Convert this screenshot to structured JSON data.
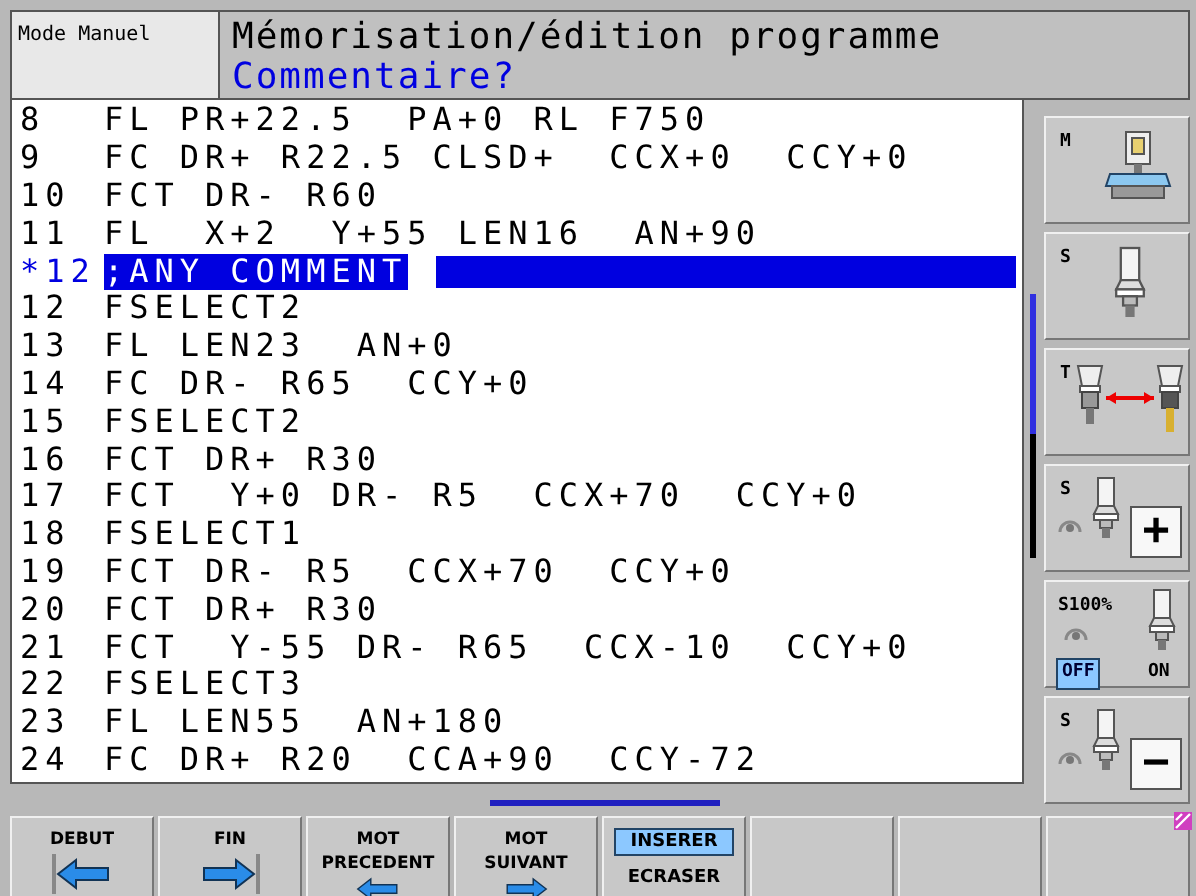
{
  "header": {
    "mode": "Mode Manuel",
    "title": "Mémorisation/édition programme",
    "prompt": "Commentaire?"
  },
  "program": {
    "lines": [
      {
        "number": "8",
        "text": "FL PR+22.5  PA+0 RL F750",
        "selected": false
      },
      {
        "number": "9",
        "text": "FC DR+ R22.5 CLSD+  CCX+0  CCY+0",
        "selected": false
      },
      {
        "number": "10",
        "text": "FCT DR- R60",
        "selected": false
      },
      {
        "number": "11",
        "text": "FL  X+2  Y+55 LEN16  AN+90",
        "selected": false
      },
      {
        "number": "*12",
        "text": ";ANY COMMENT",
        "selected": true
      },
      {
        "number": "12",
        "text": "FSELECT2",
        "selected": false
      },
      {
        "number": "13",
        "text": "FL LEN23  AN+0",
        "selected": false
      },
      {
        "number": "14",
        "text": "FC DR- R65  CCY+0",
        "selected": false
      },
      {
        "number": "15",
        "text": "FSELECT2",
        "selected": false
      },
      {
        "number": "16",
        "text": "FCT DR+ R30",
        "selected": false
      },
      {
        "number": "17",
        "text": "FCT  Y+0 DR- R5  CCX+70  CCY+0",
        "selected": false
      },
      {
        "number": "18",
        "text": "FSELECT1",
        "selected": false
      },
      {
        "number": "19",
        "text": "FCT DR- R5  CCX+70  CCY+0",
        "selected": false
      },
      {
        "number": "20",
        "text": "FCT DR+ R30",
        "selected": false
      },
      {
        "number": "21",
        "text": "FCT  Y-55 DR- R65  CCX-10  CCY+0",
        "selected": false
      },
      {
        "number": "22",
        "text": "FSELECT3",
        "selected": false
      },
      {
        "number": "23",
        "text": "FL LEN55  AN+180",
        "selected": false
      },
      {
        "number": "24",
        "text": "FC DR+ R20  CCA+90  CCY-72",
        "selected": false
      }
    ]
  },
  "side_softkeys": [
    {
      "kind": "machine",
      "label": "M"
    },
    {
      "kind": "spindle",
      "label": "S"
    },
    {
      "kind": "toolchange",
      "label": "T"
    },
    {
      "kind": "step",
      "label": "S",
      "sign": "+"
    },
    {
      "kind": "toggle",
      "label": "S100%",
      "options": [
        {
          "label": "OFF",
          "selected": true
        },
        {
          "label": "ON",
          "selected": false
        }
      ]
    },
    {
      "kind": "step",
      "label": "S",
      "sign": "−"
    }
  ],
  "softkeys": [
    {
      "kind": "start",
      "lines": [
        "DEBUT"
      ]
    },
    {
      "kind": "end",
      "lines": [
        "FIN"
      ]
    },
    {
      "kind": "previous",
      "lines": [
        "MOT",
        "PRECEDENT"
      ]
    },
    {
      "kind": "next",
      "lines": [
        "MOT",
        "SUIVANT"
      ]
    },
    {
      "kind": "toggle",
      "options": [
        {
          "label": "INSERER",
          "selected": true
        },
        {
          "label": "ECRASER",
          "selected": false
        }
      ]
    },
    {
      "kind": "empty"
    },
    {
      "kind": "empty"
    },
    {
      "kind": "empty"
    }
  ]
}
